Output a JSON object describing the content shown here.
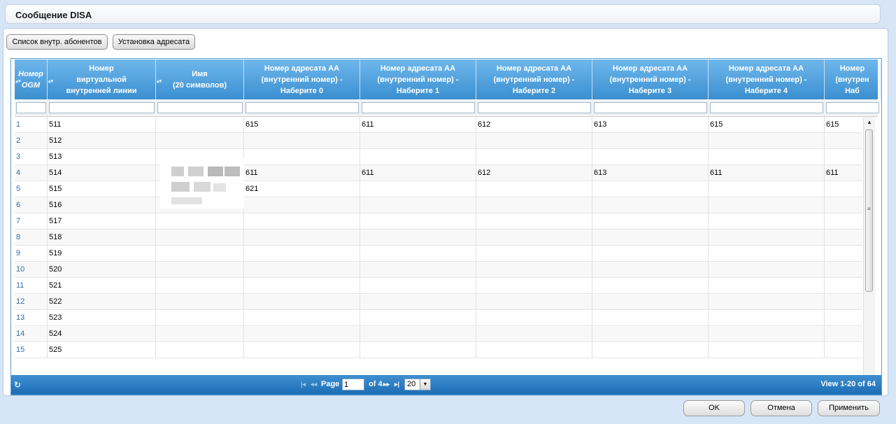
{
  "window": {
    "title": "Сообщение DISA"
  },
  "toolbar": {
    "btn_subscribers": "Список внутр. абонентов",
    "btn_dest": "Установка адресата"
  },
  "columns": [
    "Номер OGM",
    "Номер\nвиртуальной\nвнутренней линии",
    "Имя\n(20 символов)",
    "Номер адресата АА\n(внутренний номер) -\nНаберите 0",
    "Номер адресата АА\n(внутренний номер) -\nНаберите 1",
    "Номер адресата АА\n(внутренний номер) -\nНаберите 2",
    "Номер адресата АА\n(внутренний номер) -\nНаберите 3",
    "Номер адресата АА\n(внутренний номер) -\nНаберите 4",
    "Номер\n(внутрен\nНаб"
  ],
  "rows": [
    [
      "1",
      "511",
      "",
      "615",
      "611",
      "612",
      "613",
      "615",
      "615"
    ],
    [
      "2",
      "512",
      "",
      "",
      "",
      "",
      "",
      "",
      ""
    ],
    [
      "3",
      "513",
      "",
      "",
      "",
      "",
      "",
      "",
      ""
    ],
    [
      "4",
      "514",
      "",
      "611",
      "611",
      "612",
      "613",
      "611",
      "611"
    ],
    [
      "5",
      "515",
      "",
      "621",
      "",
      "",
      "",
      "",
      ""
    ],
    [
      "6",
      "516",
      "",
      "",
      "",
      "",
      "",
      "",
      ""
    ],
    [
      "7",
      "517",
      "",
      "",
      "",
      "",
      "",
      "",
      ""
    ],
    [
      "8",
      "518",
      "",
      "",
      "",
      "",
      "",
      "",
      ""
    ],
    [
      "9",
      "519",
      "",
      "",
      "",
      "",
      "",
      "",
      ""
    ],
    [
      "10",
      "520",
      "",
      "",
      "",
      "",
      "",
      "",
      ""
    ],
    [
      "11",
      "521",
      "",
      "",
      "",
      "",
      "",
      "",
      ""
    ],
    [
      "12",
      "522",
      "",
      "",
      "",
      "",
      "",
      "",
      ""
    ],
    [
      "13",
      "523",
      "",
      "",
      "",
      "",
      "",
      "",
      ""
    ],
    [
      "14",
      "524",
      "",
      "",
      "",
      "",
      "",
      "",
      ""
    ],
    [
      "15",
      "525",
      "",
      "",
      "",
      "",
      "",
      "",
      ""
    ]
  ],
  "pager": {
    "page_label": "Page",
    "page_value": "1",
    "of_label": "of 4",
    "page_size": "20",
    "view_info": "View 1-20 of 64"
  },
  "footer": {
    "ok": "OK",
    "cancel": "Отмена",
    "apply": "Применить"
  }
}
